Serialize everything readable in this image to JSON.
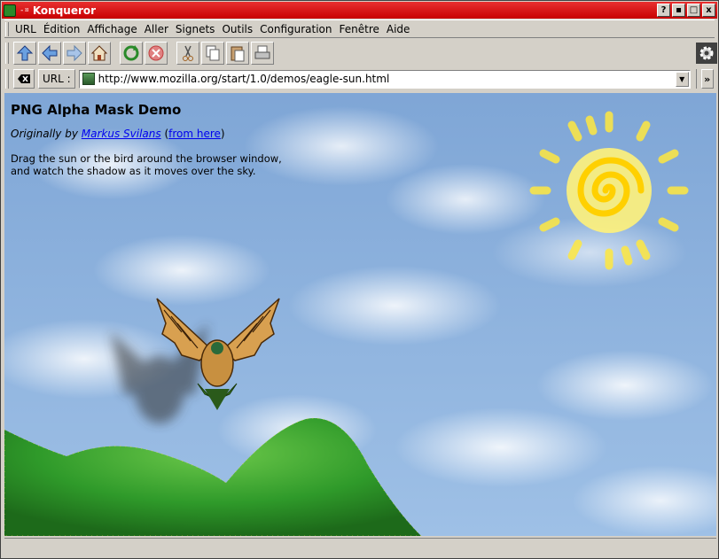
{
  "window": {
    "title": "Konqueror",
    "buttons": [
      "?",
      "▪",
      "□",
      "x"
    ]
  },
  "menu": [
    "URL",
    "Édition",
    "Affichage",
    "Aller",
    "Signets",
    "Outils",
    "Configuration",
    "Fenêtre",
    "Aide"
  ],
  "toolbar": {
    "icons": [
      "up-arrow-icon",
      "back-arrow-icon",
      "forward-arrow-icon",
      "home-icon",
      "reload-icon",
      "stop-icon",
      "cut-icon",
      "copy-icon",
      "paste-icon",
      "print-icon",
      "activity-gear-icon"
    ]
  },
  "location": {
    "label": "URL :",
    "url": "http://www.mozilla.org/start/1.0/demos/eagle-sun.html",
    "more": "»"
  },
  "page": {
    "title": "PNG Alpha Mask Demo",
    "byline_prefix": "Originally by",
    "author_link": "Markus Svilans",
    "source_link": "from here",
    "desc_line1": "Drag the sun or the bird around the browser window,",
    "desc_line2": "and watch the shadow as it moves over the sky."
  },
  "colors": {
    "titlebar": "#c80000",
    "sky": "#8fb3de",
    "hills": "#3a9a2a",
    "sun": "#ffe033",
    "link": "#0000ee"
  }
}
